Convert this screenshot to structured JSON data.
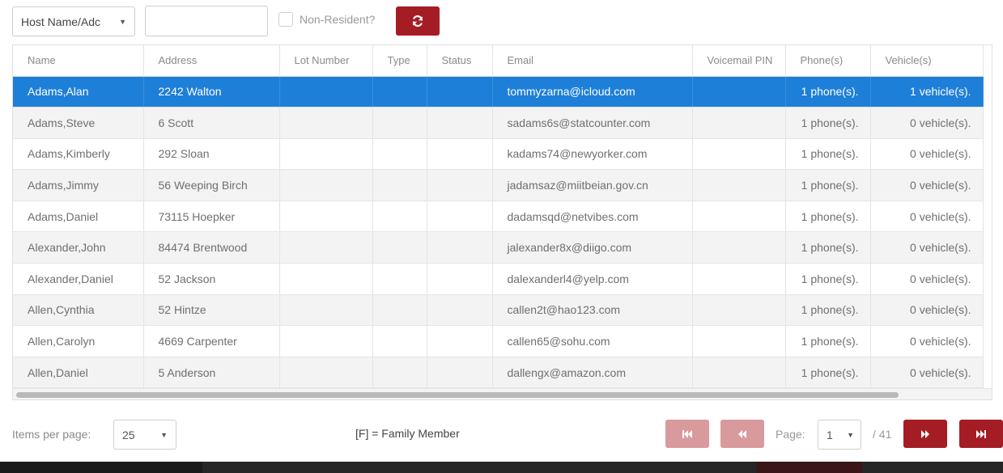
{
  "toolbar": {
    "search_field_select": "Host Name/Adc",
    "search_value": "",
    "non_resident_label": "Non-Resident?",
    "non_resident_checked": false,
    "refresh_icon": "refresh-icon"
  },
  "grid": {
    "columns": [
      "Name",
      "Address",
      "Lot Number",
      "Type",
      "Status",
      "Email",
      "Voicemail PIN",
      "Phone(s)",
      "Vehicle(s)"
    ],
    "rows": [
      {
        "name": "Adams,Alan",
        "address": "2242 Walton",
        "lot": "",
        "type": "",
        "status": "",
        "email": "tommyzarna@icloud.com",
        "pin": "",
        "phones": "1 phone(s).",
        "vehicles": "1 vehicle(s).",
        "selected": true
      },
      {
        "name": "Adams,Steve",
        "address": "6 Scott",
        "lot": "",
        "type": "",
        "status": "",
        "email": "sadams6s@statcounter.com",
        "pin": "",
        "phones": "1 phone(s).",
        "vehicles": "0 vehicle(s)."
      },
      {
        "name": "Adams,Kimberly",
        "address": "292 Sloan",
        "lot": "",
        "type": "",
        "status": "",
        "email": "kadams74@newyorker.com",
        "pin": "",
        "phones": "1 phone(s).",
        "vehicles": "0 vehicle(s)."
      },
      {
        "name": "Adams,Jimmy",
        "address": "56 Weeping Birch",
        "lot": "",
        "type": "",
        "status": "",
        "email": "jadamsaz@miitbeian.gov.cn",
        "pin": "",
        "phones": "1 phone(s).",
        "vehicles": "0 vehicle(s)."
      },
      {
        "name": "Adams,Daniel",
        "address": "73115 Hoepker",
        "lot": "",
        "type": "",
        "status": "",
        "email": "dadamsqd@netvibes.com",
        "pin": "",
        "phones": "1 phone(s).",
        "vehicles": "0 vehicle(s)."
      },
      {
        "name": "Alexander,John",
        "address": "84474 Brentwood",
        "lot": "",
        "type": "",
        "status": "",
        "email": "jalexander8x@diigo.com",
        "pin": "",
        "phones": "1 phone(s).",
        "vehicles": "0 vehicle(s)."
      },
      {
        "name": "Alexander,Daniel",
        "address": "52 Jackson",
        "lot": "",
        "type": "",
        "status": "",
        "email": "dalexanderl4@yelp.com",
        "pin": "",
        "phones": "1 phone(s).",
        "vehicles": "0 vehicle(s)."
      },
      {
        "name": "Allen,Cynthia",
        "address": "52 Hintze",
        "lot": "",
        "type": "",
        "status": "",
        "email": "callen2t@hao123.com",
        "pin": "",
        "phones": "1 phone(s).",
        "vehicles": "0 vehicle(s)."
      },
      {
        "name": "Allen,Carolyn",
        "address": "4669 Carpenter",
        "lot": "",
        "type": "",
        "status": "",
        "email": "callen65@sohu.com",
        "pin": "",
        "phones": "1 phone(s).",
        "vehicles": "0 vehicle(s)."
      },
      {
        "name": "Allen,Daniel",
        "address": "5 Anderson",
        "lot": "",
        "type": "",
        "status": "",
        "email": "dallengx@amazon.com",
        "pin": "",
        "phones": "1 phone(s).",
        "vehicles": "0 vehicle(s)."
      }
    ]
  },
  "footer": {
    "items_per_page_label": "Items per page:",
    "items_per_page_value": "25",
    "family_note": "[F] = Family Member",
    "page_label": "Page:",
    "page_value": "1",
    "page_total": "/ 41",
    "icons": {
      "first": "first-page-icon",
      "prev": "previous-page-icon",
      "next": "next-page-icon",
      "last": "last-page-icon"
    },
    "colors": {
      "active": "#a51d24",
      "disabled": "#d99a9d",
      "selected_row": "#1e7fd8"
    }
  }
}
